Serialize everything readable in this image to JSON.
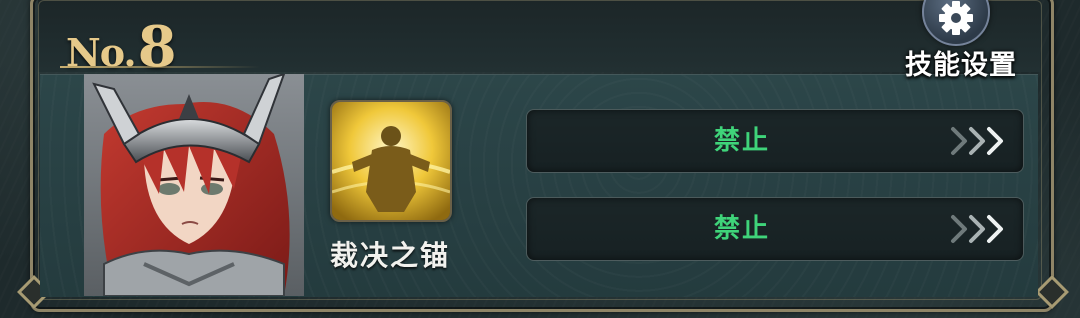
{
  "entry": {
    "prefix": "No.",
    "number": "8"
  },
  "settings": {
    "label": "技能设置",
    "icon": "gear-icon"
  },
  "character": {
    "portrait": "red-haired-knight-portrait"
  },
  "skill": {
    "name": "裁决之锚",
    "icon": "golden-warrior-skill-icon"
  },
  "options": [
    {
      "label": "禁止",
      "icon": "triple-chevron-right-icon"
    },
    {
      "label": "禁止",
      "icon": "triple-chevron-right-icon"
    }
  ],
  "colors": {
    "gold_title": "#e6c98a",
    "option_text": "#3fd47a",
    "panel": "#2c4649",
    "frame": "#8f8567"
  }
}
